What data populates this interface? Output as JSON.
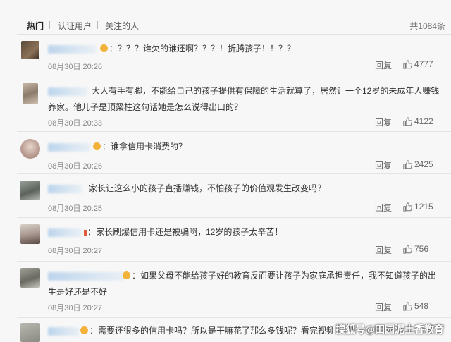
{
  "tabs": [
    {
      "label": "热门",
      "active": true
    },
    {
      "label": "认证用户",
      "active": false
    },
    {
      "label": "关注的人",
      "active": false
    }
  ],
  "total_label": "共1084条",
  "reply_label": "回复",
  "comments": [
    {
      "text": "：？？？谁欠的谁还啊？？？！折腾孩子！！？？",
      "time": "08月30日 20:26",
      "likes": "4777"
    },
    {
      "text": "大人有手有脚，不能给自己的孩子提供有保障的生活就算了，居然让一个12岁的未成年人赚钱养家。他儿子是顶梁柱这句话她是怎么说得出口的？",
      "time": "08月30日 20:33",
      "likes": "4122"
    },
    {
      "text": "：谁拿信用卡消费的？",
      "time": "08月30日 20:26",
      "likes": "2425"
    },
    {
      "text": "家长让这么小的孩子直播赚钱，不怕孩子的价值观发生改变吗？",
      "time": "08月30日 20:25",
      "likes": "1215"
    },
    {
      "text": "：家长刷爆信用卡还是被骗啊，12岁的孩子太辛苦！",
      "time": "08月30日 20:27",
      "likes": "756"
    },
    {
      "text": "：如果父母不能给孩子好的教育反而要让孩子为家庭承担责任，我不知道孩子的出生是好还是不好",
      "time": "08月30日 20:27",
      "likes": "548"
    },
    {
      "text": "：需要还很多的信用卡吗？所以是干嘛花了那么多钱呢？看完视频",
      "time": "",
      "likes": ""
    }
  ],
  "watermark": "搜狐号@田园泥土香教育",
  "colors": {
    "background": "#f7f7f7",
    "divider": "#e4e4e4",
    "muted_text": "#888888",
    "emoji": "#f3b23a"
  },
  "icons": {
    "like": "thumbs-up-icon",
    "emoji": "emoji-smile-icon"
  }
}
